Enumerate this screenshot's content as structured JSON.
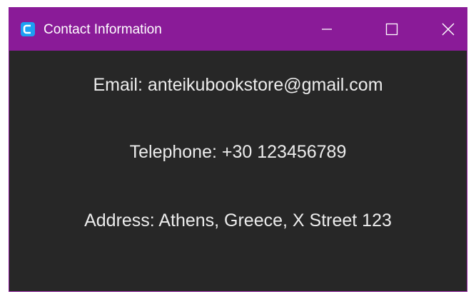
{
  "window": {
    "title": "Contact Information",
    "controls": {
      "minimize_icon": "minimize-icon",
      "maximize_icon": "maximize-icon",
      "close_icon": "close-icon"
    },
    "app_icon": "app-icon"
  },
  "contact": {
    "email": "Email: anteikubookstore@gmail.com",
    "telephone": "Telephone: +30 123456789",
    "address": "Address: Athens, Greece, X Street 123"
  },
  "colors": {
    "titlebar": "#8a1b98",
    "background": "#272727",
    "text": "#ececec",
    "app_icon": "#1ca0f2"
  }
}
